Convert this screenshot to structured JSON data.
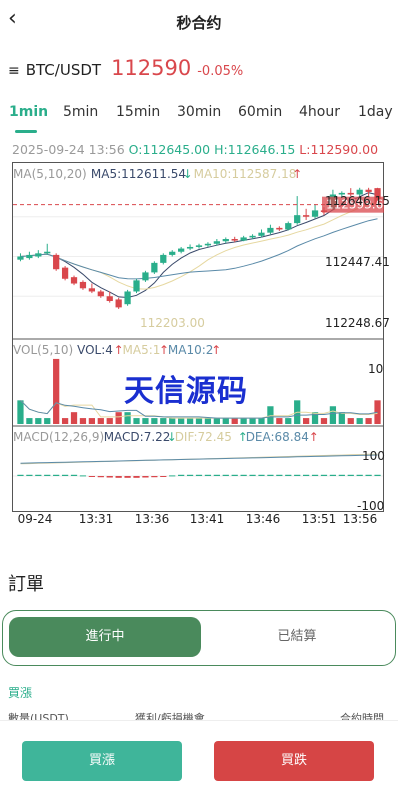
{
  "header": {
    "back_icon": "chevron-left-icon",
    "title": "秒合约"
  },
  "pair": {
    "menu_icon": "hamburger-menu-icon",
    "symbol": "BTC/USDT",
    "price": "112590",
    "change": "-0.05%"
  },
  "timeframes": [
    {
      "label": "1min",
      "active": true
    },
    {
      "label": "5min",
      "active": false
    },
    {
      "label": "15min",
      "active": false
    },
    {
      "label": "30min",
      "active": false
    },
    {
      "label": "60min",
      "active": false
    },
    {
      "label": "4hour",
      "active": false
    },
    {
      "label": "1day",
      "active": false
    }
  ],
  "ohlc": {
    "date": "2025-09-24",
    "time": "13:56",
    "open": "O:112645.00",
    "high": "H:112646.15",
    "low": "L:112590.00"
  },
  "chart_data": {
    "type": "candlestick",
    "main": {
      "ma_label": "MA(5,10,20)",
      "ma5_label": "MA5:112611.54",
      "ma5_arrow": "↓",
      "ma10_label": "MA10:112587.18",
      "ma10_arrow": "↑",
      "y_ticks": [
        "112646.15",
        "112447.41",
        "112248.67"
      ],
      "current_price_tag": "112593.67",
      "low_marker": "112203.00",
      "ylim": [
        112180,
        112680
      ],
      "candles": [
        {
          "o": 112420,
          "c": 112430,
          "h": 112440,
          "l": 112415
        },
        {
          "o": 112425,
          "c": 112435,
          "h": 112445,
          "l": 112420
        },
        {
          "o": 112430,
          "c": 112440,
          "h": 112450,
          "l": 112425
        },
        {
          "o": 112440,
          "c": 112445,
          "h": 112470,
          "l": 112435
        },
        {
          "o": 112435,
          "c": 112390,
          "h": 112440,
          "l": 112385
        },
        {
          "o": 112395,
          "c": 112360,
          "h": 112400,
          "l": 112355
        },
        {
          "o": 112365,
          "c": 112345,
          "h": 112370,
          "l": 112340
        },
        {
          "o": 112350,
          "c": 112330,
          "h": 112355,
          "l": 112325
        },
        {
          "o": 112330,
          "c": 112320,
          "h": 112345,
          "l": 112315
        },
        {
          "o": 112320,
          "c": 112305,
          "h": 112325,
          "l": 112300
        },
        {
          "o": 112305,
          "c": 112290,
          "h": 112320,
          "l": 112285
        },
        {
          "o": 112295,
          "c": 112270,
          "h": 112300,
          "l": 112265
        },
        {
          "o": 112280,
          "c": 112320,
          "h": 112325,
          "l": 112275
        },
        {
          "o": 112320,
          "c": 112355,
          "h": 112360,
          "l": 112315
        },
        {
          "o": 112355,
          "c": 112380,
          "h": 112385,
          "l": 112350
        },
        {
          "o": 112380,
          "c": 112410,
          "h": 112415,
          "l": 112375
        },
        {
          "o": 112410,
          "c": 112435,
          "h": 112440,
          "l": 112405
        },
        {
          "o": 112435,
          "c": 112445,
          "h": 112450,
          "l": 112430
        },
        {
          "o": 112445,
          "c": 112455,
          "h": 112460,
          "l": 112440
        },
        {
          "o": 112455,
          "c": 112460,
          "h": 112468,
          "l": 112450
        },
        {
          "o": 112460,
          "c": 112465,
          "h": 112470,
          "l": 112455
        },
        {
          "o": 112465,
          "c": 112470,
          "h": 112475,
          "l": 112460
        },
        {
          "o": 112470,
          "c": 112478,
          "h": 112485,
          "l": 112465
        },
        {
          "o": 112478,
          "c": 112485,
          "h": 112490,
          "l": 112472
        },
        {
          "o": 112485,
          "c": 112480,
          "h": 112492,
          "l": 112475
        },
        {
          "o": 112480,
          "c": 112490,
          "h": 112495,
          "l": 112478
        },
        {
          "o": 112490,
          "c": 112495,
          "h": 112500,
          "l": 112485
        },
        {
          "o": 112495,
          "c": 112505,
          "h": 112515,
          "l": 112490
        },
        {
          "o": 112505,
          "c": 112520,
          "h": 112530,
          "l": 112500
        },
        {
          "o": 112520,
          "c": 112515,
          "h": 112525,
          "l": 112510
        },
        {
          "o": 112515,
          "c": 112535,
          "h": 112540,
          "l": 112512
        },
        {
          "o": 112535,
          "c": 112560,
          "h": 112620,
          "l": 112530
        },
        {
          "o": 112560,
          "c": 112555,
          "h": 112580,
          "l": 112545
        },
        {
          "o": 112555,
          "c": 112575,
          "h": 112595,
          "l": 112550
        },
        {
          "o": 112575,
          "c": 112570,
          "h": 112585,
          "l": 112560
        },
        {
          "o": 112580,
          "c": 112625,
          "h": 112640,
          "l": 112575
        },
        {
          "o": 112625,
          "c": 112630,
          "h": 112635,
          "l": 112615
        },
        {
          "o": 112630,
          "c": 112625,
          "h": 112645,
          "l": 112620
        },
        {
          "o": 112625,
          "c": 112640,
          "h": 112646,
          "l": 112618
        },
        {
          "o": 112640,
          "c": 112633,
          "h": 112646,
          "l": 112620
        },
        {
          "o": 112645,
          "c": 112593,
          "h": 112646,
          "l": 112590
        }
      ]
    },
    "volume": {
      "label": "VOL(5,10)",
      "vol_label": "VOL:4",
      "vol_arrow": "↑",
      "ma5_label": "MA5:1",
      "ma5_arrow": "↑",
      "ma10_label": "MA10:2",
      "ma10_arrow": "↑",
      "y_tick": "10",
      "ylim": [
        0,
        12
      ],
      "values": [
        4,
        1,
        1,
        1,
        11,
        1,
        2,
        1,
        1,
        1,
        1,
        2,
        2,
        1,
        1,
        1,
        1,
        1,
        1,
        1,
        1,
        1,
        1,
        1,
        1,
        1,
        1,
        1,
        3,
        1,
        1,
        4,
        1,
        2,
        1,
        3,
        2,
        1,
        1,
        1,
        4
      ]
    },
    "macd": {
      "label": "MACD(12,26,9)",
      "macd_label": "MACD:7.22",
      "macd_arrow": "↓",
      "dif_label": "DIF:72.45",
      "dif_arrow": "↑",
      "dea_label": "DEA:68.84",
      "dea_arrow": "↑",
      "y_ticks": [
        "100",
        "-100"
      ],
      "ylim": [
        -115,
        115
      ],
      "hist": [
        4,
        4,
        4,
        4,
        4,
        4,
        4,
        2,
        -2,
        -4,
        -5,
        -6,
        -6,
        -6,
        -5,
        -4,
        -2,
        2,
        4,
        4,
        4,
        4,
        4,
        4,
        4,
        4,
        4,
        4,
        4,
        4,
        4,
        4,
        4,
        4,
        4,
        4,
        4,
        4,
        4,
        4,
        4
      ]
    },
    "x_ticks": [
      "09-24",
      "13:31",
      "13:36",
      "13:41",
      "13:46",
      "13:51",
      "13:56"
    ]
  },
  "watermark": "天信源码",
  "orders": {
    "title": "訂單",
    "tabs": {
      "active": "進行中",
      "inactive": "已結算"
    },
    "section_label": "買漲",
    "columns": [
      "數量(USDT)",
      "獲利/虧損機會",
      "合約時間"
    ]
  },
  "actions": {
    "buy_up": "買漲",
    "buy_down": "買跌"
  },
  "colors": {
    "up": "#2aae8b",
    "down": "#d9474c",
    "accent_green": "#4a8a5c",
    "buy_button": "#3fb59a",
    "sell_button": "#d64545"
  }
}
